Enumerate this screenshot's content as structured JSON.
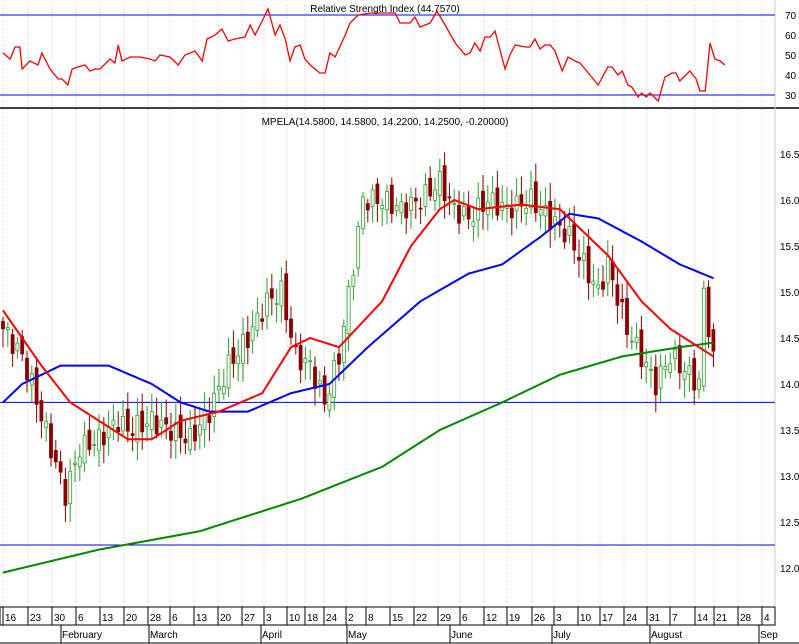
{
  "chart_data": {
    "type": "candlestick",
    "colors": {
      "up": "#2e9e2e",
      "down": "#8b0000",
      "ma_short": "#ff0000",
      "ma_mid": "#0000ff",
      "ma_long": "#008800",
      "hline": "#0000ff",
      "rsi": "#ff0000"
    },
    "rsi_panel": {
      "title": "Relative Strength Index (44.7570)",
      "ylim": [
        23,
        75
      ],
      "yticks": [
        30,
        40,
        50,
        60,
        70
      ],
      "levels": [
        30,
        70
      ],
      "points": [
        [
          0,
          51
        ],
        [
          1.5,
          48
        ],
        [
          2.5,
          54
        ],
        [
          3.5,
          54
        ],
        [
          4,
          43
        ],
        [
          5.6,
          47
        ],
        [
          7.3,
          45
        ],
        [
          8.1,
          51
        ],
        [
          9.8,
          43
        ],
        [
          11.5,
          38
        ],
        [
          12.3,
          38
        ],
        [
          13.5,
          35
        ],
        [
          14.4,
          43
        ],
        [
          15.6,
          44
        ],
        [
          17.1,
          45
        ],
        [
          18.1,
          42
        ],
        [
          19.2,
          43
        ],
        [
          20.2,
          43
        ],
        [
          22.3,
          48
        ],
        [
          23.3,
          46
        ],
        [
          24,
          55
        ],
        [
          24.8,
          47
        ],
        [
          26.5,
          49
        ],
        [
          28.5,
          49
        ],
        [
          30.6,
          48
        ],
        [
          31.7,
          47
        ],
        [
          32.7,
          50
        ],
        [
          34.8,
          49
        ],
        [
          36.5,
          45
        ],
        [
          37.9,
          50
        ],
        [
          40,
          52
        ],
        [
          41.5,
          47
        ],
        [
          42.5,
          58
        ],
        [
          44.2,
          60
        ],
        [
          45.6,
          63
        ],
        [
          46.9,
          57
        ],
        [
          48.3,
          58
        ],
        [
          50.4,
          59
        ],
        [
          51.5,
          65
        ],
        [
          52.5,
          60
        ],
        [
          54,
          67
        ],
        [
          55.2,
          73
        ],
        [
          56.7,
          60
        ],
        [
          57.7,
          65
        ],
        [
          58.8,
          58
        ],
        [
          59.8,
          47
        ],
        [
          60.8,
          54
        ],
        [
          61.9,
          55
        ],
        [
          62.9,
          48
        ],
        [
          64,
          45
        ],
        [
          66,
          41
        ],
        [
          67.1,
          41
        ],
        [
          68.1,
          51
        ],
        [
          69.2,
          49
        ],
        [
          71.3,
          60
        ],
        [
          72.3,
          66
        ],
        [
          74,
          70
        ],
        [
          76.5,
          71
        ],
        [
          81.7,
          71
        ],
        [
          82.7,
          66
        ],
        [
          84.8,
          66
        ],
        [
          85.8,
          69
        ],
        [
          86.9,
          64
        ],
        [
          89,
          66
        ],
        [
          90.4,
          72
        ],
        [
          92.1,
          65
        ],
        [
          94.2,
          56
        ],
        [
          96.3,
          50
        ],
        [
          97.3,
          51
        ],
        [
          98.3,
          56
        ],
        [
          99.4,
          52
        ],
        [
          100.4,
          59
        ],
        [
          101.5,
          59
        ],
        [
          102.5,
          62
        ],
        [
          104.6,
          43
        ],
        [
          105.6,
          50
        ],
        [
          106.7,
          55
        ],
        [
          108.8,
          54
        ],
        [
          109.8,
          54
        ],
        [
          110.8,
          58
        ],
        [
          111.9,
          53
        ],
        [
          112.9,
          55
        ],
        [
          114,
          55
        ],
        [
          115,
          52
        ],
        [
          116.5,
          42
        ],
        [
          117.7,
          49
        ],
        [
          119.2,
          47
        ],
        [
          120.2,
          46
        ],
        [
          122.3,
          40
        ],
        [
          124,
          35
        ],
        [
          126,
          44
        ],
        [
          126.9,
          44
        ],
        [
          128.1,
          40
        ],
        [
          129,
          42
        ],
        [
          130.2,
          35
        ],
        [
          131,
          34
        ],
        [
          132.3,
          29
        ],
        [
          133.1,
          31
        ],
        [
          134,
          29
        ],
        [
          134.8,
          31
        ],
        [
          136.5,
          27
        ],
        [
          137.9,
          39
        ],
        [
          139.4,
          41
        ],
        [
          140.2,
          41
        ],
        [
          141,
          37
        ],
        [
          143.1,
          42
        ],
        [
          144.4,
          38
        ],
        [
          145.2,
          32
        ],
        [
          146.3,
          32
        ],
        [
          147.3,
          56
        ],
        [
          148.3,
          48
        ],
        [
          149.4,
          47
        ],
        [
          150.4,
          45
        ]
      ]
    },
    "price_panel": {
      "title": "MPELA(14.5800, 14.5800, 14.2200, 14.2500, -0.20000)",
      "ylim": [
        11.85,
        16.85
      ],
      "yticks": [
        12.0,
        12.5,
        13.0,
        13.5,
        14.0,
        14.5,
        15.0,
        15.5,
        16.0,
        16.5
      ],
      "hlines": [
        13.8,
        12.25
      ],
      "close_keypoints": [
        [
          0,
          14.6
        ],
        [
          4,
          14.3
        ],
        [
          6,
          14.0
        ],
        [
          10,
          13.3
        ],
        [
          13,
          12.8
        ],
        [
          16,
          13.3
        ],
        [
          20,
          13.4
        ],
        [
          24,
          13.6
        ],
        [
          26,
          13.5
        ],
        [
          31,
          13.6
        ],
        [
          35,
          13.5
        ],
        [
          39,
          13.4
        ],
        [
          43,
          13.7
        ],
        [
          47,
          14.2
        ],
        [
          51,
          14.5
        ],
        [
          55,
          14.9
        ],
        [
          58,
          15.0
        ],
        [
          61,
          14.3
        ],
        [
          64,
          14.2
        ],
        [
          67,
          13.8
        ],
        [
          70,
          14.3
        ],
        [
          73,
          15.3
        ],
        [
          75,
          16.0
        ],
        [
          79,
          16.0
        ],
        [
          83,
          15.9
        ],
        [
          87,
          16.0
        ],
        [
          91,
          16.2
        ],
        [
          94,
          15.9
        ],
        [
          97,
          15.8
        ],
        [
          101,
          16.0
        ],
        [
          105,
          15.9
        ],
        [
          110,
          16.0
        ],
        [
          114,
          15.8
        ],
        [
          118,
          15.6
        ],
        [
          122,
          15.2
        ],
        [
          124,
          15.0
        ],
        [
          126,
          15.3
        ],
        [
          130,
          14.6
        ],
        [
          133,
          14.3
        ],
        [
          136,
          14.0
        ],
        [
          139,
          14.3
        ],
        [
          143,
          14.1
        ],
        [
          145,
          14.0
        ],
        [
          146,
          15.0
        ],
        [
          148,
          14.25
        ]
      ],
      "ma_short": [
        [
          0,
          14.8
        ],
        [
          8,
          14.2
        ],
        [
          14,
          13.8
        ],
        [
          20,
          13.6
        ],
        [
          26,
          13.4
        ],
        [
          31,
          13.4
        ],
        [
          37,
          13.6
        ],
        [
          45,
          13.7
        ],
        [
          54,
          13.9
        ],
        [
          60,
          14.4
        ],
        [
          64,
          14.5
        ],
        [
          70,
          14.4
        ],
        [
          79,
          14.9
        ],
        [
          85,
          15.5
        ],
        [
          91,
          15.9
        ],
        [
          94,
          16.0
        ],
        [
          99,
          15.9
        ],
        [
          108,
          15.95
        ],
        [
          116,
          15.9
        ],
        [
          122,
          15.6
        ],
        [
          126,
          15.4
        ],
        [
          133,
          14.9
        ],
        [
          139,
          14.6
        ],
        [
          145,
          14.4
        ],
        [
          148,
          14.3
        ]
      ],
      "ma_mid": [
        [
          0,
          13.8
        ],
        [
          4,
          14.0
        ],
        [
          12,
          14.2
        ],
        [
          22,
          14.2
        ],
        [
          31,
          14.0
        ],
        [
          37,
          13.8
        ],
        [
          43,
          13.7
        ],
        [
          51,
          13.7
        ],
        [
          60,
          13.9
        ],
        [
          68,
          14.0
        ],
        [
          76,
          14.4
        ],
        [
          87,
          14.9
        ],
        [
          97,
          15.2
        ],
        [
          104,
          15.3
        ],
        [
          112,
          15.6
        ],
        [
          118,
          15.85
        ],
        [
          124,
          15.8
        ],
        [
          133,
          15.55
        ],
        [
          141,
          15.3
        ],
        [
          148,
          15.15
        ]
      ],
      "ma_long": [
        [
          0,
          11.95
        ],
        [
          20,
          12.2
        ],
        [
          41,
          12.4
        ],
        [
          62,
          12.75
        ],
        [
          79,
          13.1
        ],
        [
          91,
          13.5
        ],
        [
          104,
          13.8
        ],
        [
          116,
          14.1
        ],
        [
          129,
          14.3
        ],
        [
          141,
          14.4
        ],
        [
          148,
          14.45
        ]
      ]
    },
    "x_axis": {
      "week_labels": [
        "16",
        "23",
        "30",
        "6",
        "13",
        "20",
        "28",
        "6",
        "13",
        "20",
        "27",
        "3",
        "10",
        "18",
        "24",
        "2",
        "8",
        "15",
        "22",
        "29",
        "6",
        "12",
        "19",
        "26",
        "3",
        "10",
        "17",
        "24",
        "31",
        "7",
        "14",
        "21",
        "28",
        "4"
      ],
      "month_labels": [
        "February",
        "March",
        "April",
        "May",
        "June",
        "July",
        "August",
        "Sep"
      ]
    }
  }
}
